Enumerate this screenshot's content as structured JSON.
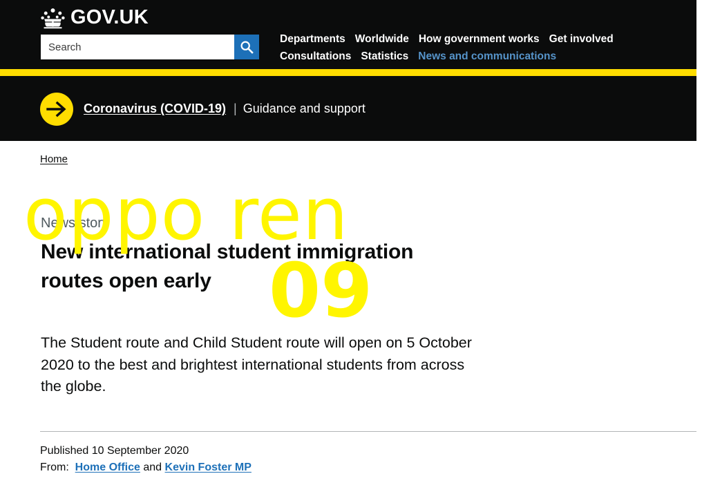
{
  "header": {
    "logo_text": "GOV.UK",
    "crown_icon": "crown-icon",
    "search": {
      "placeholder": "Search",
      "value": "",
      "button_icon": "search-icon"
    },
    "nav": [
      {
        "label": "Departments",
        "current": false
      },
      {
        "label": "Worldwide",
        "current": false
      },
      {
        "label": "How government works",
        "current": false
      },
      {
        "label": "Get involved",
        "current": false
      },
      {
        "label": "Consultations",
        "current": false
      },
      {
        "label": "Statistics",
        "current": false
      },
      {
        "label": "News and communications",
        "current": true
      }
    ]
  },
  "covid_banner": {
    "arrow_icon": "arrow-right-icon",
    "link_label": "Coronavirus (COVID-19)",
    "separator": "|",
    "subtitle": "Guidance and support"
  },
  "breadcrumb": {
    "items": [
      "Home"
    ]
  },
  "article": {
    "kicker": "News story",
    "headline": "New international student immigration routes open early",
    "lede": "The Student route and Child Student route will open on 5 October 2020 to the best and brightest international students from across the globe.",
    "published": "Published 10 September 2020",
    "from_label": "From:",
    "from_orgs": [
      "Home Office",
      "Kevin Foster MP"
    ],
    "from_conjunction": "and"
  },
  "watermark": {
    "line1": "oppo ren",
    "line2": "09",
    "color": "#fff500"
  },
  "colors": {
    "header_black": "#0b0c0c",
    "govuk_yellow": "#ffdd00",
    "link_blue": "#1d70b8",
    "nav_current_blue": "#5694ca",
    "muted_grey": "#505a5f",
    "rule_grey": "#b1b4b6"
  }
}
